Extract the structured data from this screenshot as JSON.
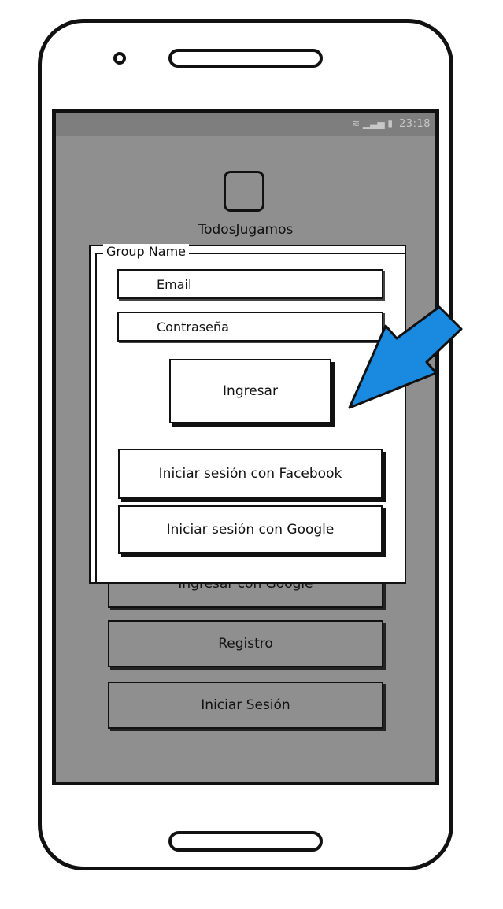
{
  "status_bar": {
    "time": "23:18",
    "icons": "wifi-signal-battery"
  },
  "app": {
    "name": "TodosJugamos"
  },
  "background_buttons": [
    {
      "label": "Ingresar con Google"
    },
    {
      "label": "Registro"
    },
    {
      "label": "Iniciar Sesión"
    }
  ],
  "login_panel": {
    "group_label": "Group Name",
    "email_placeholder": "Email",
    "password_placeholder": "Contraseña",
    "submit_label": "Ingresar",
    "facebook_label": "Iniciar sesión con Facebook",
    "google_label": "Iniciar sesión con Google"
  },
  "colors": {
    "screen_bg": "#8f8f8f",
    "arrow_fill": "#1a8ae0",
    "outline": "#111111"
  },
  "annotation": {
    "icon": "blue-arrow-pointer"
  }
}
